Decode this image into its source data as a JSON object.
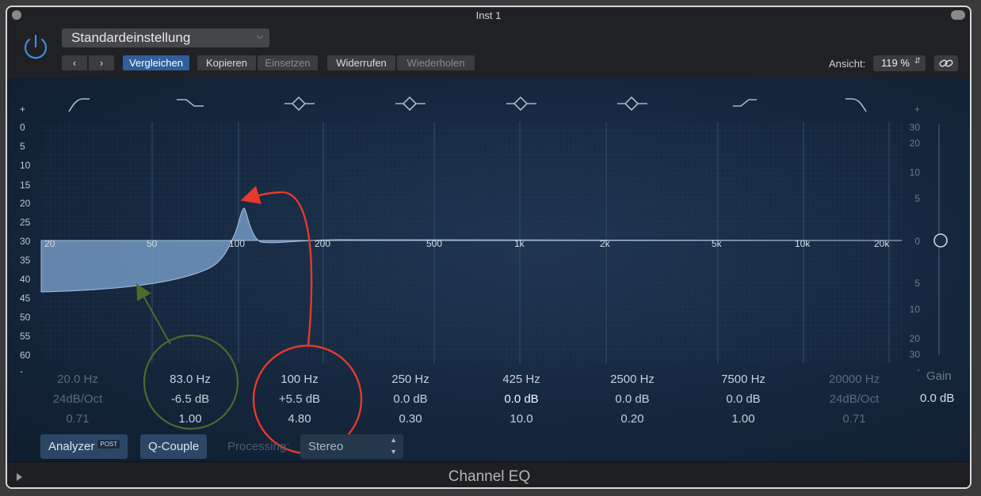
{
  "window": {
    "title": "Inst 1"
  },
  "toolbar": {
    "preset": "Standardeinstellung",
    "back_icon": "chevron-left-icon",
    "forward_icon": "chevron-right-icon",
    "compare_label": "Vergleichen",
    "copy_label": "Kopieren",
    "paste_label": "Einsetzen",
    "undo_label": "Widerrufen",
    "redo_label": "Wiederholen",
    "view_label": "Ansicht:",
    "zoom_value": "119 %"
  },
  "eq": {
    "left_axis": [
      "+",
      "0",
      "5",
      "10",
      "15",
      "20",
      "25",
      "30",
      "35",
      "40",
      "45",
      "50",
      "55",
      "60",
      "-"
    ],
    "right_axis": [
      "+",
      "30",
      "20",
      "10",
      "5",
      "0",
      "5",
      "10",
      "20",
      "30",
      "-"
    ],
    "freq_labels": [
      "20",
      "50",
      "100",
      "200",
      "500",
      "1k",
      "2k",
      "5k",
      "10k",
      "20k"
    ],
    "bands": [
      {
        "freq": "20.0 Hz",
        "gain": "24dB/Oct",
        "q": "0.71",
        "active": false,
        "icon": "low-cut-icon"
      },
      {
        "freq": "83.0 Hz",
        "gain": "-6.5 dB",
        "q": "1.00",
        "active": true,
        "icon": "low-shelf-icon"
      },
      {
        "freq": "100 Hz",
        "gain": "+5.5 dB",
        "q": "4.80",
        "active": true,
        "icon": "bell-icon"
      },
      {
        "freq": "250 Hz",
        "gain": "0.0 dB",
        "q": "0.30",
        "active": true,
        "icon": "bell-icon"
      },
      {
        "freq": "425 Hz",
        "gain": "0.0 dB",
        "q": "10.0",
        "active": true,
        "icon": "bell-icon"
      },
      {
        "freq": "2500 Hz",
        "gain": "0.0 dB",
        "q": "0.20",
        "active": true,
        "icon": "bell-icon"
      },
      {
        "freq": "7500 Hz",
        "gain": "0.0 dB",
        "q": "1.00",
        "active": true,
        "icon": "high-shelf-icon"
      },
      {
        "freq": "20000 Hz",
        "gain": "24dB/Oct",
        "q": "0.71",
        "active": false,
        "icon": "high-cut-icon"
      }
    ],
    "gain_label": "Gain",
    "gain_value": "0.0 dB"
  },
  "controls": {
    "analyzer_label": "Analyzer",
    "analyzer_badge": "POST",
    "qcouple_label": "Q-Couple",
    "processing_label": "Processing:",
    "processing_value": "Stereo"
  },
  "footer": {
    "title": "Channel EQ"
  },
  "colors": {
    "accent_blue": "#2f5f9c",
    "curve_fill": "#6f94be",
    "annotation_green": "#4f6a2a",
    "annotation_red": "#e8392c"
  }
}
